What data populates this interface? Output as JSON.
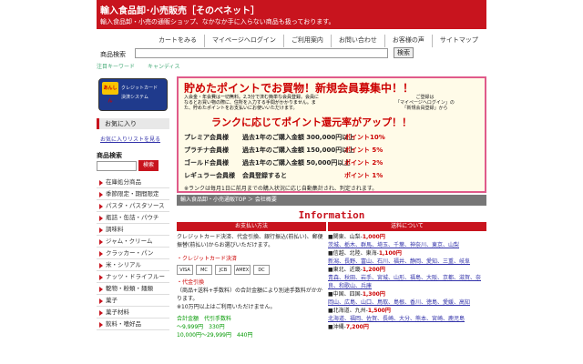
{
  "header": {
    "title": "輸入食品卸･小売販売［そのべネット］",
    "tagline": "輸入食品卸・小売の通販ショップ、なかなか手に入らない商品も扱っております。"
  },
  "topnav": [
    "カートをみる",
    "マイページへログイン",
    "ご利用案内",
    "お問い合わせ",
    "お客様の声",
    "サイトマップ"
  ],
  "search": {
    "label": "商品検索",
    "button": "検索"
  },
  "keywords": [
    "注目キーワード",
    "キャンディス"
  ],
  "card_logo": {
    "tag": "あんしん",
    "line1": "クレジットカード",
    "line2": "決済システム"
  },
  "sidebar": {
    "fav_head": "お気に入り",
    "fav_link": "お気に入りリストを見る",
    "product_search": "商品検索",
    "product_search_btn": "検索",
    "categories": [
      "在庫処分商品",
      "季節限定・期間限定",
      "パスタ・パスタソース",
      "瓶詰・缶詰・パウチ",
      "調味料",
      "ジャム・クリーム",
      "クラッカー・パン",
      "米・シリアル",
      "ナッツ・ドライフルーツ",
      "乾物・粉類・麺類",
      "菓子",
      "菓子材料",
      "飲料・嗜好品"
    ]
  },
  "banner": {
    "h1": "貯めたポイントでお買物！新規会員募集中！！",
    "small": "入会金・年会費は一切無料。2,3分で済む簡単な会員登録。会員になるとお買い物の際に、住所を入力する手間がかかりません。また、貯めたポイントをお支払いにお使いいただけます。",
    "note_1": "ご登録は",
    "note_2": "「マイページへログイン」の",
    "note_3": "「新規会員登録」から",
    "h2": "ランクに応じてポイント還元率がアップ！！",
    "ranks": [
      {
        "name": "プレミア会員様",
        "cond": "過去1年のご購入金額 300,000円以上",
        "pt": "ポイント10%"
      },
      {
        "name": "プラチナ会員様",
        "cond": "過去1年のご購入金額 150,000円以上",
        "pt": "ポイント 5%"
      },
      {
        "name": "ゴールド会員様",
        "cond": "過去1年のご購入金額 50,000円以上",
        "pt": "ポイント 2%"
      },
      {
        "name": "レギュラー会員様",
        "cond": "会員登録すると",
        "pt": "ポイント 1%"
      }
    ],
    "foot": "※ランクは毎月1日に前月までの購入状況に応じ自動集計され、判定されます。"
  },
  "crumb": "輸入食品卸・小売通販TOP ＞ 会社概要",
  "info_title": "Information",
  "payment": {
    "head": "お支払い方法",
    "intro": "クレジットカード決済、代金引換、銀行振込(前払い)、郵便振替(前払い)からお選びいただけます。",
    "cc_head": "・クレジットカード決済",
    "cards": [
      "VISA",
      "MC",
      "JCB",
      "AMEX",
      "DC"
    ],
    "cod_head": "・代金引換",
    "cod_text": "（商品+送料+手数料）の合計金額により別途手数料がかかります。",
    "cod_note": "※10万円以上はご利用いただけません。",
    "table_head": "合計金額　代引手数料",
    "row1": "～9,999円　330円",
    "row2": "10,000円～29,999円　440円"
  },
  "shipping": {
    "head": "送料について",
    "regions": [
      {
        "name": "■関東、山梨-",
        "fee": "1,000円",
        "prefs": "茨城、栃木、群馬、埼玉、千葉、神奈川、東京、山梨"
      },
      {
        "name": "■信越、北陸、東海-",
        "fee": "1,100円",
        "prefs": "新潟、長野、富山、石川、福井、静岡、愛知、三重、岐阜"
      },
      {
        "name": "■東北、近畿-",
        "fee": "1,200円",
        "prefs": "青森、秋田、岩手、宮城、山形、福島、大阪、京都、滋賀、奈良、和歌山、兵庫"
      },
      {
        "name": "■中国、四国-",
        "fee": "1,300円",
        "prefs": "岡山、広島、山口、鳥取、島根、香川、徳島、愛媛、高知"
      },
      {
        "name": "■北海道、九州-",
        "fee": "1,500円",
        "prefs": "北海道、福岡、佐賀、長崎、大分、熊本、宮崎、鹿児島"
      },
      {
        "name": "■沖縄-",
        "fee": "7,200円",
        "prefs": ""
      }
    ]
  }
}
